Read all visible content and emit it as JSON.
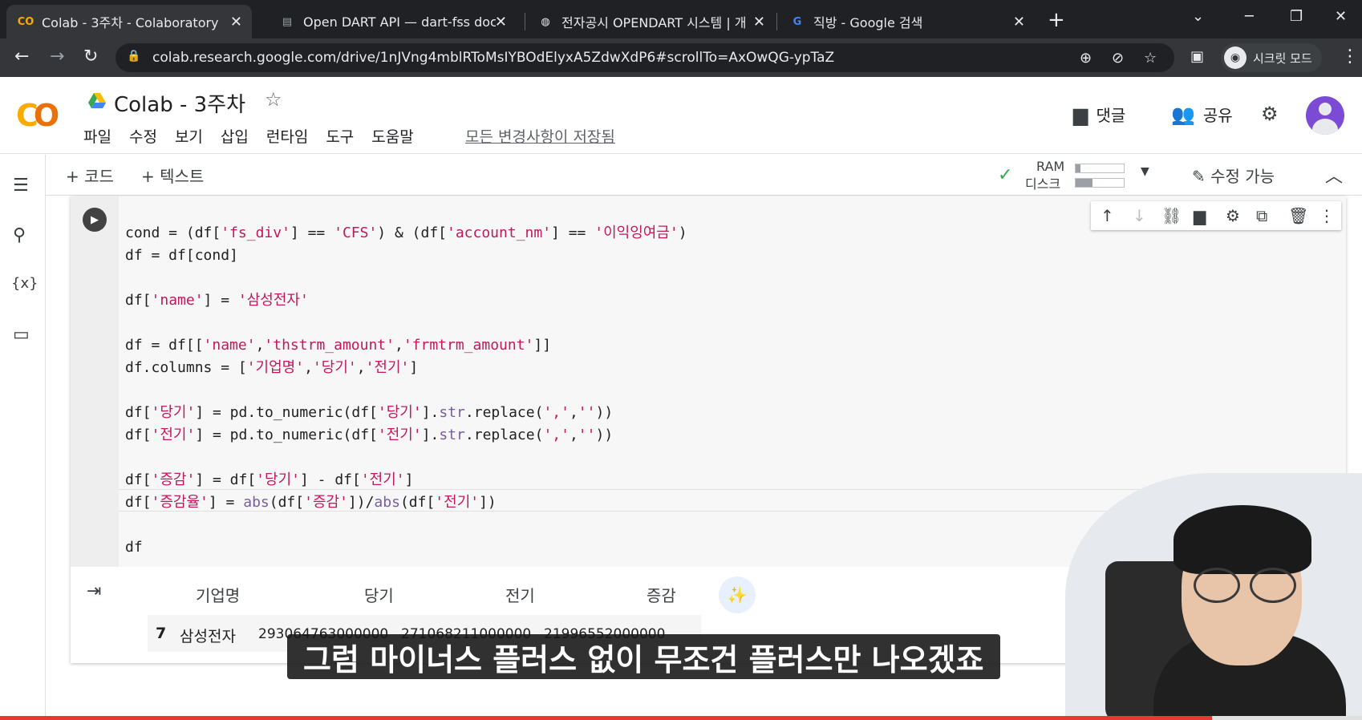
{
  "browser": {
    "tabs": [
      {
        "title": "Colab - 3주차 - Colaboratory",
        "favicon": "CO"
      },
      {
        "title": "Open DART API — dart-fss doc",
        "favicon": "book-icon"
      },
      {
        "title": "전자공시 OPENDART 시스템 | 개",
        "favicon": "globe-icon"
      },
      {
        "title": "직방 - Google 검색",
        "favicon": "G"
      }
    ],
    "url": "colab.research.google.com/drive/1nJVng4mblRToMsIYBOdElyxA5ZdwXdP6#scrollTo=AxOwQG-ypTaZ",
    "incognito_label": "시크릿 모드"
  },
  "colab": {
    "title": "Colab - 3주차",
    "menu": [
      "파일",
      "수정",
      "보기",
      "삽입",
      "런타임",
      "도구",
      "도움말"
    ],
    "saved_status": "모든 변경사항이 저장됨",
    "comment_label": "댓글",
    "share_label": "공유",
    "add_code": "+ 코드",
    "add_text": "+ 텍스트",
    "ram_label": "RAM",
    "disk_label": "디스크",
    "ram_usage": 0.1,
    "disk_usage": 0.35,
    "editable_label": "수정 가능"
  },
  "code_lines": [
    "",
    "cond = (df['fs_div'] == 'CFS') & (df['account_nm'] == '이익잉여금')",
    "df = df[cond]",
    "",
    "df['name'] = '삼성전자'",
    "",
    "df = df[['name','thstrm_amount','frmtrm_amount']]",
    "df.columns = ['기업명','당기','전기']",
    "",
    "df['당기'] = pd.to_numeric(df['당기'].str.replace(',',''))",
    "df['전기'] = pd.to_numeric(df['전기'].str.replace(',',''))",
    "",
    "df['증감'] = df['당기'] - df['전기']",
    "df['증감율'] = abs(df['증감'])/abs(df['전기'])",
    "",
    "df"
  ],
  "output": {
    "headers": [
      "기업명",
      "당기",
      "전기",
      "증감"
    ],
    "rows": [
      {
        "index": "7",
        "name": "삼성전자",
        "current": "293064763000000",
        "previous": "271068211000000",
        "change": "21996552000000"
      }
    ]
  },
  "subtitle": "그럼 마이너스 플러스 없이 무조건 플러스만 나오겠죠",
  "video_progress": 0.89
}
